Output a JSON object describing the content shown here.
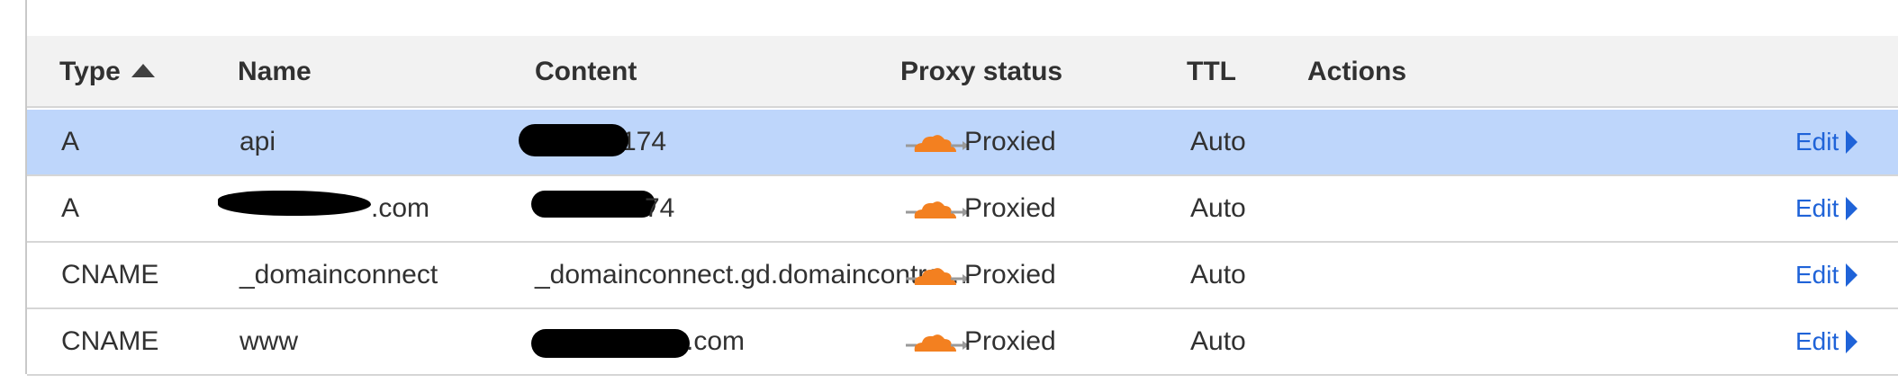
{
  "table": {
    "headers": {
      "type": "Type",
      "name": "Name",
      "content": "Content",
      "proxy_status": "Proxy status",
      "ttl": "TTL",
      "actions": "Actions"
    },
    "sort": {
      "column": "Type",
      "direction": "ascending"
    },
    "rows": [
      {
        "type": "A",
        "name": "api",
        "content": "174",
        "proxy": "Proxied",
        "ttl": "Auto",
        "action": "Edit",
        "selected": true
      },
      {
        "type": "A",
        "name": ".com",
        "content": "74",
        "proxy": "Proxied",
        "ttl": "Auto",
        "action": "Edit",
        "selected": false
      },
      {
        "type": "CNAME",
        "name": "_domainconnect",
        "content": "_domainconnect.gd.domaincontro…",
        "proxy": "Proxied",
        "ttl": "Auto",
        "action": "Edit",
        "selected": false
      },
      {
        "type": "CNAME",
        "name": "www",
        "content": ".com",
        "proxy": "Proxied",
        "ttl": "Auto",
        "action": "Edit",
        "selected": false
      }
    ]
  },
  "icons": {
    "proxy": "cloud-proxied-icon",
    "sort": "sort-ascending-icon",
    "edit": "caret-right-icon"
  },
  "colors": {
    "selected_row": "#bed6fb",
    "header_bg": "#f2f2f2",
    "link": "#1f63d8",
    "cloud_orange": "#f38020",
    "cloud_arrow": "#9a9a9a",
    "redaction": "#000000"
  }
}
